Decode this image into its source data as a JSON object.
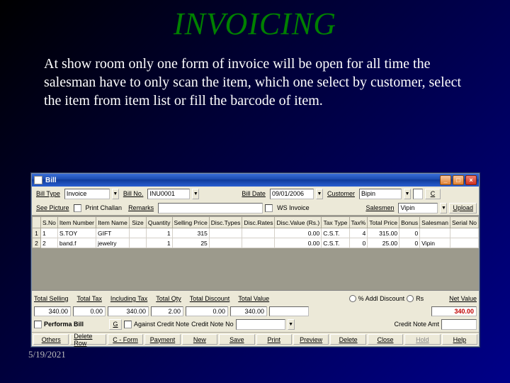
{
  "page": {
    "heading": "INVOICING",
    "description": "At show room only one form of invoice will be open for all time the salesman have to only scan the item, which one select by customer, select the item from item list or fill the barcode of item.",
    "date_stamp": "5/19/2021"
  },
  "window": {
    "title": "Bill",
    "row1": {
      "bill_type_label": "Bill Type",
      "bill_type_value": "Invoice",
      "bill_no_label": "Bill No.",
      "bill_no_value": "INU0001",
      "bill_date_label": "Bill Date",
      "bill_date_value": "09/01/2006",
      "customer_label": "Customer",
      "customer_value": "Bipin",
      "c_button": "C"
    },
    "row2": {
      "see_picture_label": "See Picture",
      "print_challan_label": "Print Challan",
      "remarks_label": "Remarks",
      "remarks_value": "",
      "ws_invoice_label": "WS Invoice",
      "salesmen_label": "Salesmen",
      "salesmen_value": "Vipin",
      "upload_label": "Upload"
    },
    "grid": {
      "headers": [
        "S.No",
        "Item Number",
        "Item Name",
        "Size",
        "Quantity",
        "Selling Price",
        "Disc.Types",
        "Disc.Rates",
        "Disc.Value (Rs.)",
        "Tax Type",
        "Tax%",
        "Total Price",
        "Bonus",
        "Salesman",
        "Serial No"
      ],
      "rows": [
        {
          "sno": "1",
          "item_number": "S.TOY",
          "item_name": "GIFT",
          "size": "",
          "quantity": "1",
          "selling_price": "315",
          "disc_types": "",
          "disc_rates": "",
          "disc_value": "0.00",
          "tax_type": "C.S.T.",
          "tax_pct": "4",
          "total_price": "315.00",
          "bonus": "0",
          "salesman": "",
          "serial": ""
        },
        {
          "sno": "2",
          "item_number": "band.f",
          "item_name": "jewelry",
          "size": "",
          "quantity": "1",
          "selling_price": "25",
          "disc_types": "",
          "disc_rates": "",
          "disc_value": "0.00",
          "tax_type": "C.S.T.",
          "tax_pct": "0",
          "total_price": "25.00",
          "bonus": "0",
          "salesman": "Vipin",
          "serial": ""
        }
      ]
    },
    "totals": {
      "total_selling_label": "Total Selling",
      "total_selling": "340.00",
      "total_tax_label": "Total Tax",
      "total_tax": "0.00",
      "including_tax_label": "Including Tax",
      "including_tax": "340.00",
      "total_qty_label": "Total Qty",
      "total_qty": "2.00",
      "total_discount_label": "Total Discount",
      "total_discount": "0.00",
      "total_value_label": "Total Value",
      "total_value": "340.00",
      "pct_addl_discount_label": "% Addl Discount",
      "rs_label": "Rs",
      "net_value_label": "Net Value",
      "net_value": "340.00"
    },
    "footer": {
      "performa_label": "Performa Bill",
      "g_button": "G",
      "against_cn_label": "Against Credit Note",
      "cn_no_label": "Credit Note No",
      "cn_no_value": "",
      "cn_amt_label": "Credit Note Amt"
    },
    "buttons": {
      "others": "Others",
      "delete_row": "Delete Row",
      "cform": "C - Form",
      "payment": "Payment",
      "new": "New",
      "save": "Save",
      "print": "Print",
      "preview": "Preview",
      "delete": "Delete",
      "close": "Close",
      "hold": "Hold",
      "help": "Help"
    }
  }
}
